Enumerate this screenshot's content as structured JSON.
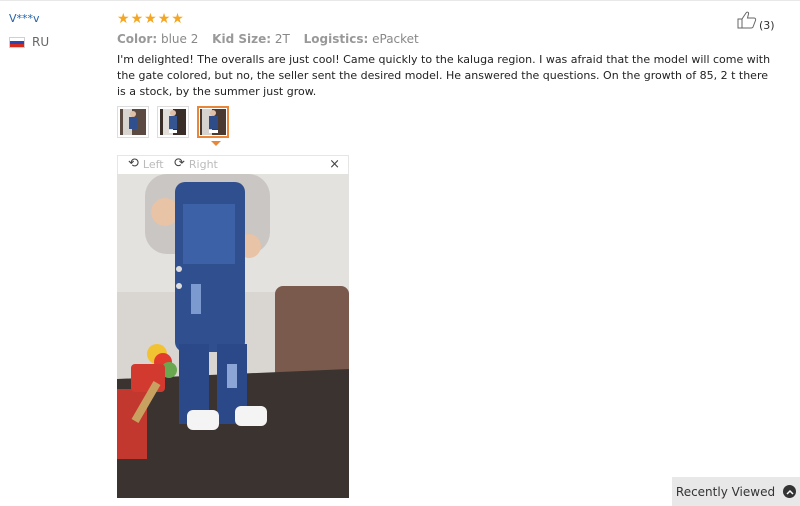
{
  "reviewer": {
    "name": "V***v",
    "country": "RU"
  },
  "rating": {
    "stars": 5,
    "max": 5
  },
  "helpful": {
    "count": "(3)"
  },
  "attributes": [
    {
      "key": "Color:",
      "value": "blue 2"
    },
    {
      "key": "Kid Size:",
      "value": "2T"
    },
    {
      "key": "Logistics:",
      "value": "ePacket"
    }
  ],
  "review_text": "I'm delighted! The overalls are just cool! Came quickly to the kaluga region. I was afraid that the model will come with the gate colored, but no, the seller sent the desired model. He answered the questions. On the growth of 85, 2 t there is a stock, by the summer just grow.",
  "viewer": {
    "rotate_left": "Left",
    "rotate_right": "Right",
    "close": "×"
  },
  "thumbnails": {
    "count": 3,
    "active_index": 2
  },
  "recently_viewed": {
    "label": "Recently Viewed"
  },
  "colors": {
    "star": "#f5a623",
    "accent_border": "#e8873a",
    "link": "#2563a8"
  },
  "icons": [
    "thumbs-up-icon",
    "rotate-left-icon",
    "rotate-right-icon",
    "close-icon",
    "chevron-up-icon",
    "star-icon",
    "russia-flag-icon"
  ]
}
